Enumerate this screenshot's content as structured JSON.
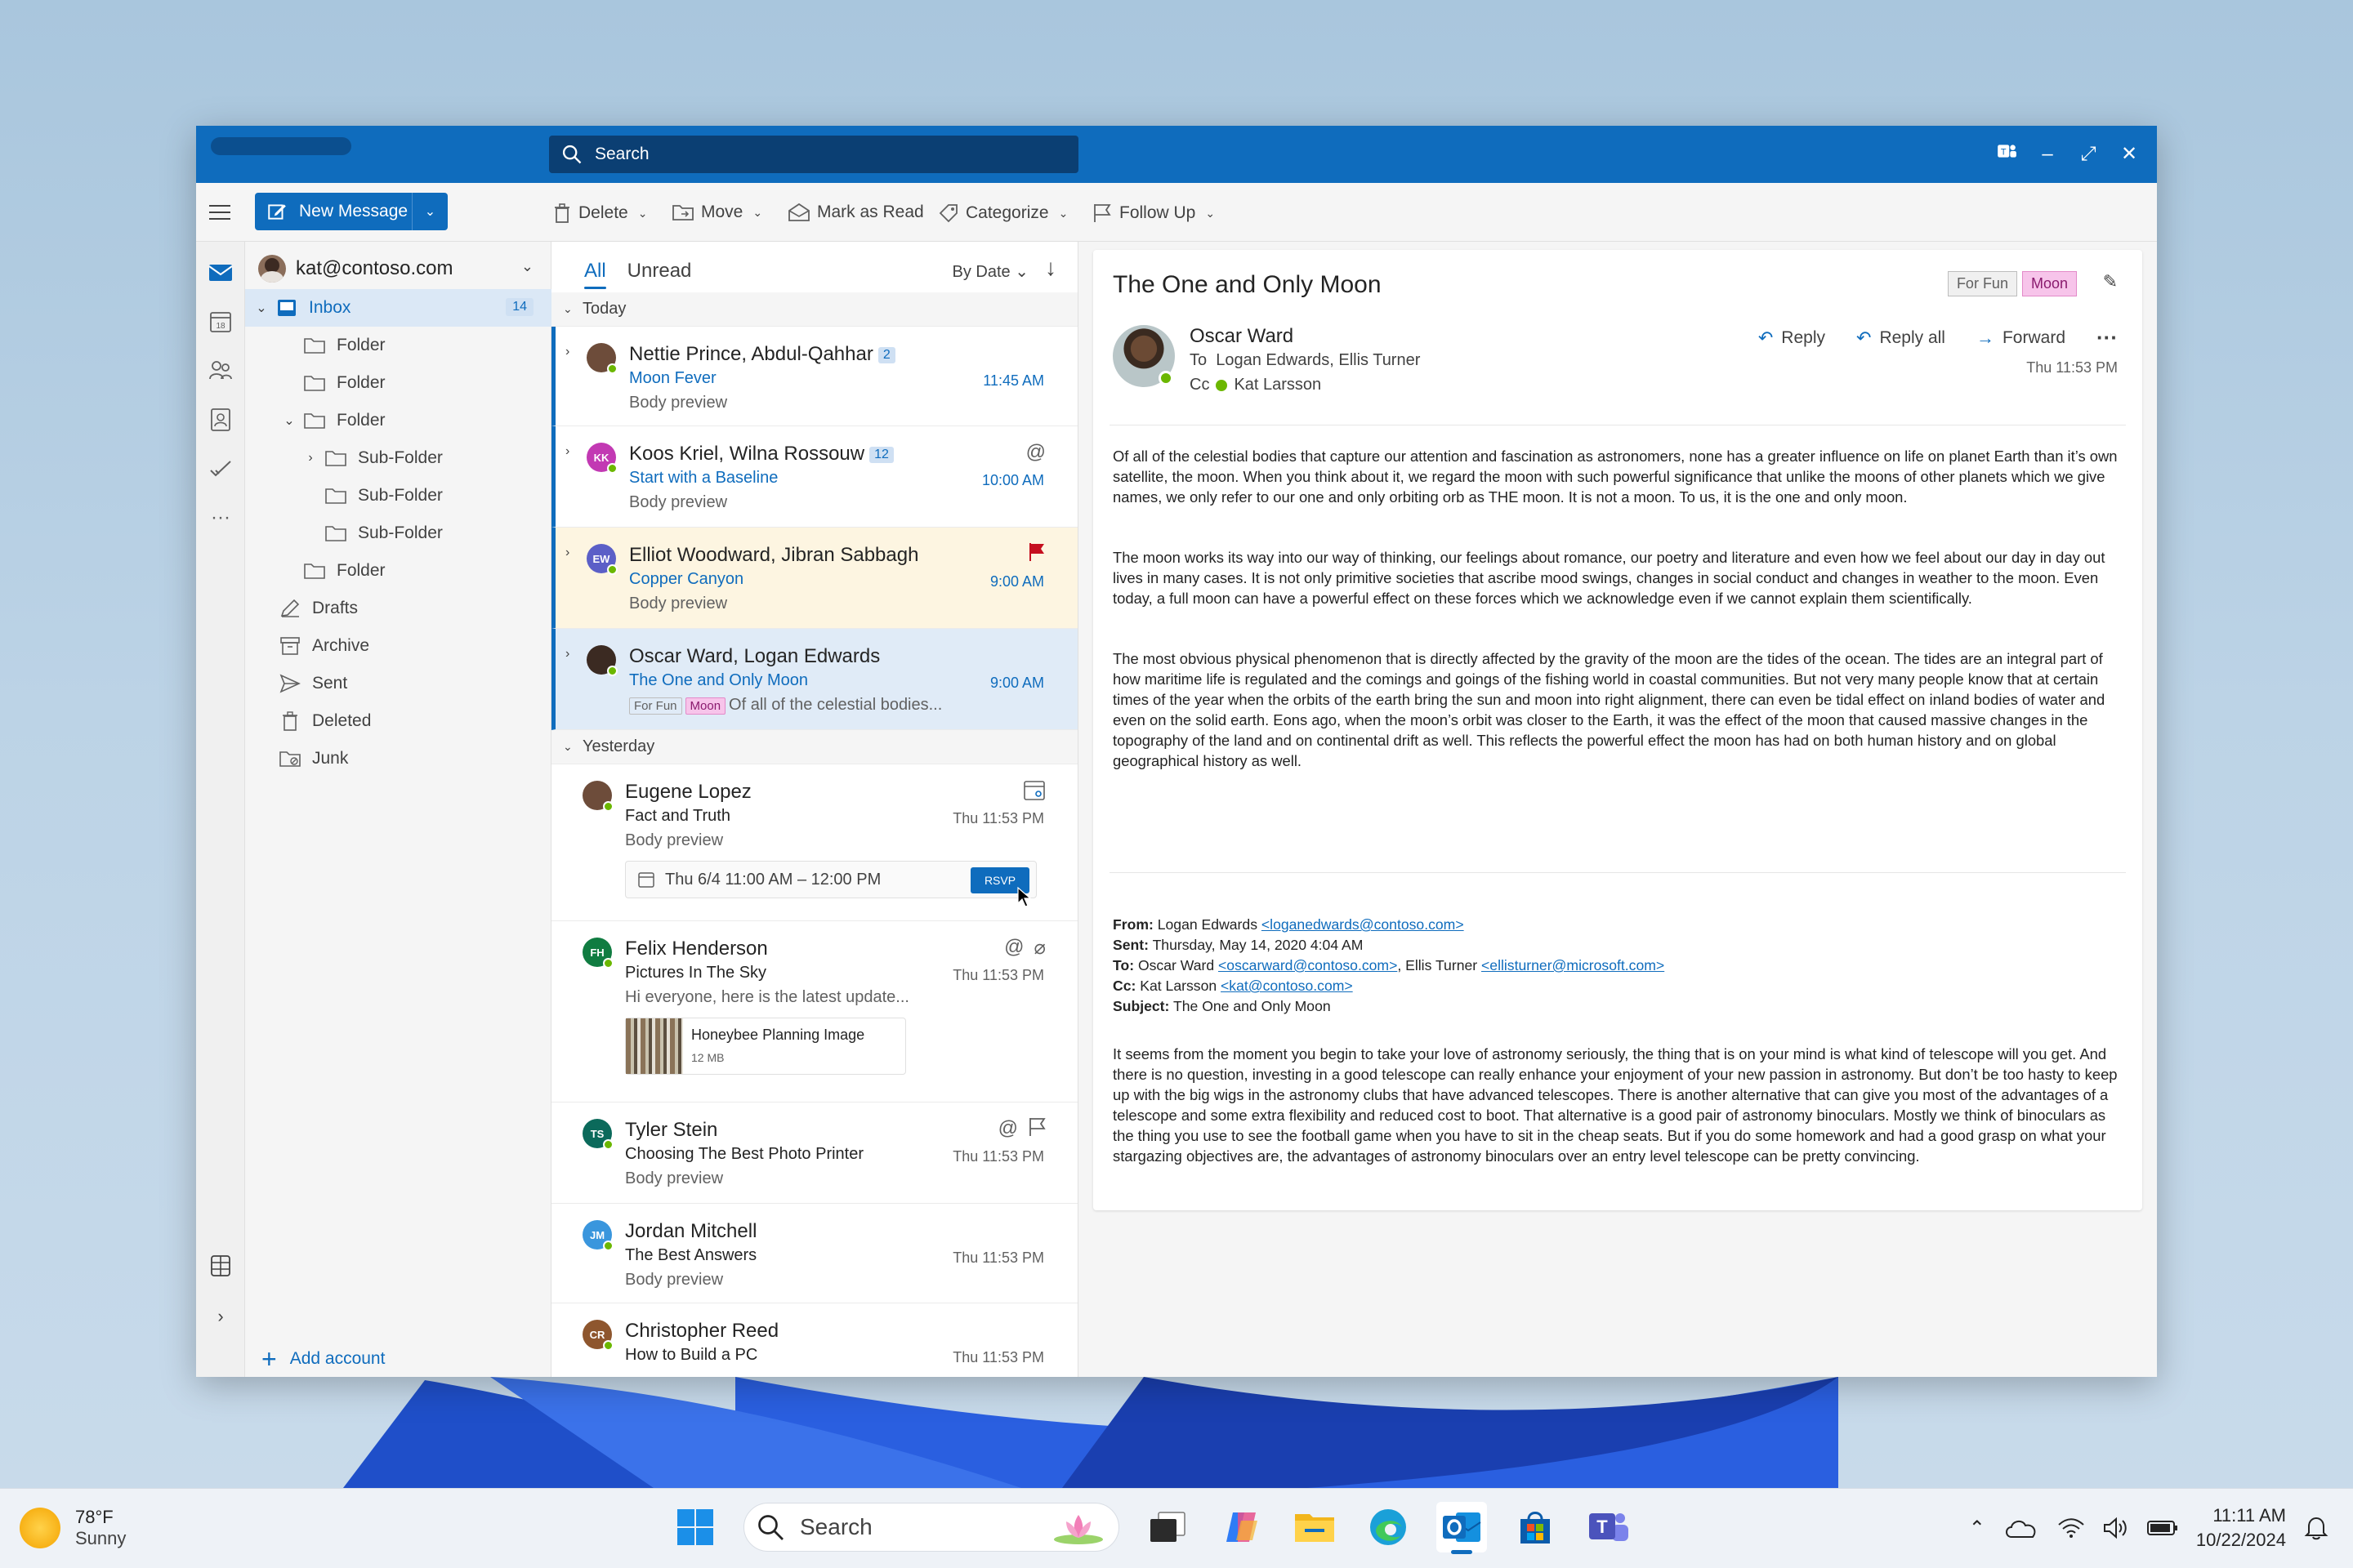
{
  "window": {
    "search_placeholder": "Search"
  },
  "toolbar": {
    "new_message": "New Message",
    "delete": "Delete",
    "move": "Move",
    "mark_as_read": "Mark as Read",
    "categorize": "Categorize",
    "follow_up": "Follow Up"
  },
  "account": {
    "email": "kat@contoso.com"
  },
  "folders": {
    "inbox": "Inbox",
    "inbox_count": "14",
    "folder": "Folder",
    "sub_folder": "Sub-Folder",
    "drafts": "Drafts",
    "archive": "Archive",
    "sent": "Sent",
    "deleted": "Deleted",
    "junk": "Junk",
    "add_account": "Add account"
  },
  "list": {
    "tab_all": "All",
    "tab_unread": "Unread",
    "sort": "By Date",
    "group_today": "Today",
    "group_yesterday": "Yesterday",
    "messages": [
      {
        "from": "Nettie Prince, Abdul-Qahhar",
        "count": "2",
        "subject": "Moon Fever",
        "preview": "Body preview",
        "time": "11:45 AM"
      },
      {
        "from": "Koos Kriel, Wilna Rossouw",
        "initials": "KK",
        "count": "12",
        "subject": "Start with a Baseline",
        "preview": "Body preview",
        "time": "10:00 AM"
      },
      {
        "from": "Elliot Woodward, Jibran Sabbagh",
        "initials": "EW",
        "subject": "Copper Canyon",
        "preview": "Body preview",
        "time": "9:00 AM"
      },
      {
        "from": "Oscar Ward, Logan Edwards",
        "subject": "The One and Only Moon",
        "tag1": "For Fun",
        "tag2": "Moon",
        "preview": "Of all of the celestial bodies...",
        "time": "9:00 AM"
      },
      {
        "from": "Eugene Lopez",
        "subject": "Fact and Truth",
        "preview": "Body preview",
        "time": "Thu 11:53 PM",
        "event": "Thu 6/4 11:00 AM – 12:00 PM",
        "rsvp": "RSVP"
      },
      {
        "from": "Felix Henderson",
        "initials": "FH",
        "subject": "Pictures In The Sky",
        "preview": "Hi everyone, here is the latest update...",
        "time": "Thu 11:53 PM",
        "attachment_name": "Honeybee Planning Image",
        "attachment_size": "12 MB"
      },
      {
        "from": "Tyler Stein",
        "initials": "TS",
        "subject": "Choosing The Best Photo Printer",
        "preview": "Body preview",
        "time": "Thu 11:53 PM"
      },
      {
        "from": "Jordan Mitchell",
        "initials": "JM",
        "subject": "The Best Answers",
        "preview": "Body preview",
        "time": "Thu 11:53 PM"
      },
      {
        "from": "Christopher Reed",
        "initials": "CR",
        "subject": "How to Build a PC",
        "time": "Thu 11:53 PM"
      }
    ]
  },
  "reading": {
    "title": "The One and Only Moon",
    "tag1": "For Fun",
    "tag2": "Moon",
    "sender": "Oscar Ward",
    "to_label": "To",
    "to": "Logan Edwards, Ellis Turner",
    "cc_label": "Cc",
    "cc": "Kat Larsson",
    "reply": "Reply",
    "reply_all": "Reply all",
    "forward": "Forward",
    "time": "Thu 11:53 PM",
    "p1": "Of all of the celestial bodies that capture our attention and fascination as astronomers, none has a greater influence on life on planet Earth than it’s own satellite, the moon. When you think about it, we regard the moon with such powerful significance that unlike the moons of other planets which we give names, we only refer to our one and only orbiting orb as THE moon. It is not a moon. To us, it is the one and only moon.",
    "p2": "The moon works its way into our way of thinking, our feelings about romance, our poetry and literature and even how we feel about our day in day out lives in many cases. It is not only primitive societies that ascribe mood swings, changes in social conduct and changes in weather to the moon. Even today, a full moon can have a powerful effect on these forces which we acknowledge even if we cannot explain them scientifically.",
    "p3": "The most obvious physical phenomenon that is directly affected by the gravity of the moon are the tides of the ocean. The tides are an integral part of how maritime life is regulated and the comings and goings of the fishing world in coastal communities. But not very many people know that at certain times of the year when the orbits of the earth bring the sun and moon into right alignment, there can even be tidal effect on inland bodies of water and even on the solid earth. Eons ago, when the moon’s orbit was closer to the Earth, it was the effect of the moon that caused massive changes in the topography of the land and on continental drift as well. This reflects the powerful effect the moon has had on both human history and on global geographical history as well.",
    "from_label": "From:",
    "from_name": "Logan Edwards",
    "from_email": "<loganedwards@contoso.com>",
    "sent_label": "Sent:",
    "sent_value": "Thursday, May 14, 2020 4:04 AM",
    "to2_label": "To:",
    "to2_name1": "Oscar Ward",
    "to2_email1": "<oscarward@contoso.com>",
    "to2_name2": "Ellis Turner",
    "to2_email2": "<ellisturner@microsoft.com>",
    "cc2_label": "Cc:",
    "cc2_name": "Kat Larsson",
    "cc2_email": "<kat@contoso.com>",
    "subject_label": "Subject:",
    "subject_value": "The One and Only Moon",
    "p4": "It seems from the moment you begin to take your love of astronomy seriously, the thing that is on your mind is what kind of telescope will you get. And there is no question, investing in a good telescope can really enhance your enjoyment of your new passion in astronomy. But don’t be too hasty to keep up with the big wigs in the astronomy clubs that have advanced telescopes. There is another alternative that can give you most of the advantages of a telescope and some extra flexibility and reduced cost to boot. That alternative is a good pair of astronomy binoculars. Mostly we think of binoculars as the thing you use to see the football game when you have to sit in the cheap seats. But if you do some homework and had a good grasp on what your stargazing objectives are, the advantages of astronomy binoculars over an entry level telescope can be pretty convincing."
  },
  "taskbar": {
    "temp": "78°F",
    "condition": "Sunny",
    "search": "Search",
    "time": "11:11 AM",
    "date": "10/22/2024"
  }
}
